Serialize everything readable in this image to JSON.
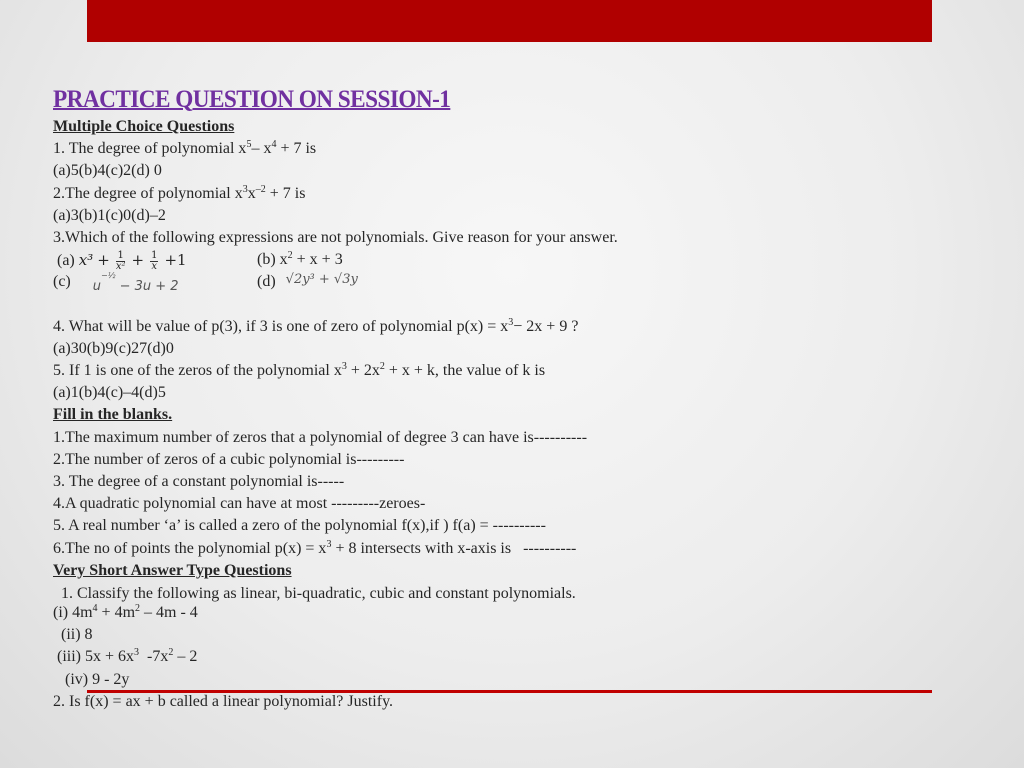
{
  "colors": {
    "top_bar": "#b00000",
    "title": "#7030a0",
    "rule": "#c00000"
  },
  "title": "PRACTICE QUESTION ON SESSION-1",
  "mcq": {
    "heading": "Multiple Choice Questions",
    "q1": {
      "text_a": "1. The degree of polynomial x",
      "sup1": "5",
      "text_b": "– x",
      "sup2": "4",
      "text_c": " + 7 is",
      "options": "(a)5(b)4(c)2(d) 0"
    },
    "q2": {
      "text_a": "2.The degree of polynomial x",
      "sup1": "3",
      "text_b": "x",
      "sup2": "–2",
      "text_c": " + 7 is",
      "options": "(a)3(b)1(c)0(d)–2"
    },
    "q3": {
      "text": "3.Which of the following expressions are not polynomials. Give reason for your answer.",
      "a_label": "(a)",
      "a_x3": "x³",
      "a_plus": "+",
      "a_frac1_num": "1",
      "a_frac1_den": "x²",
      "a_frac2_num": "1",
      "a_frac2_den": "x",
      "a_tail": "+1",
      "b_label": "(b) x",
      "b_sup": "2",
      "b_tail": " + x + 3",
      "c_label": "(c)",
      "c_base": "u",
      "c_exp": "−½",
      "c_tail": " − 3u + 2",
      "d_label": "(d)",
      "d_expr": "√2y³ + √3y"
    },
    "q4": {
      "text_a": "4. What will be value of p(3), if 3 is one of zero of polynomial p(x) = x",
      "sup1": "3",
      "text_b": "− 2x + 9 ?",
      "options": "(a)30(b)9(c)27(d)0"
    },
    "q5": {
      "text_a": " 5. If 1 is one of the zeros of the polynomial x",
      "sup1": "3",
      "text_b": " + 2x",
      "sup2": "2",
      "text_c": " + x + k, the value of k is",
      "options": "(a)1(b)4(c)–4(d)5"
    }
  },
  "fill": {
    "heading": "Fill in the blanks.",
    "items": [
      "1.The maximum number of zeros that a polynomial of degree 3 can have is----------",
      "2.The number of zeros of a cubic polynomial is---------",
      "3. The degree of a constant polynomial is-----",
      "4.A quadratic polynomial can have at most ---------zeroes-",
      "5. A real number ‘a’ is called a zero of the polynomial f(x),if ) f(a) = ----------"
    ],
    "item6": {
      "text_a": "6.The no of points the polynomial p(x) = x",
      "sup1": "3",
      "text_b": " + 8 intersects with x-axis is   ----------"
    }
  },
  "vsa": {
    "heading": "Very Short Answer Type Questions",
    "q1": "  1. Classify the following as linear, bi-quadratic, cubic and constant polynomials.",
    "i": {
      "text_a": "(i) 4m",
      "sup1": "4",
      "text_b": " + 4m",
      "sup2": "2",
      "text_c": " – 4m - 4"
    },
    "ii": "(ii) 8",
    "iii": {
      "text_a": "(iii) 5x + 6x",
      "sup1": "3",
      "text_b": "  -7x",
      "sup2": "2",
      "text_c": " – 2"
    },
    "iv": "(iv) 9 - 2y",
    "q2": "2. Is f(x) = ax + b called a linear polynomial? Justify."
  }
}
